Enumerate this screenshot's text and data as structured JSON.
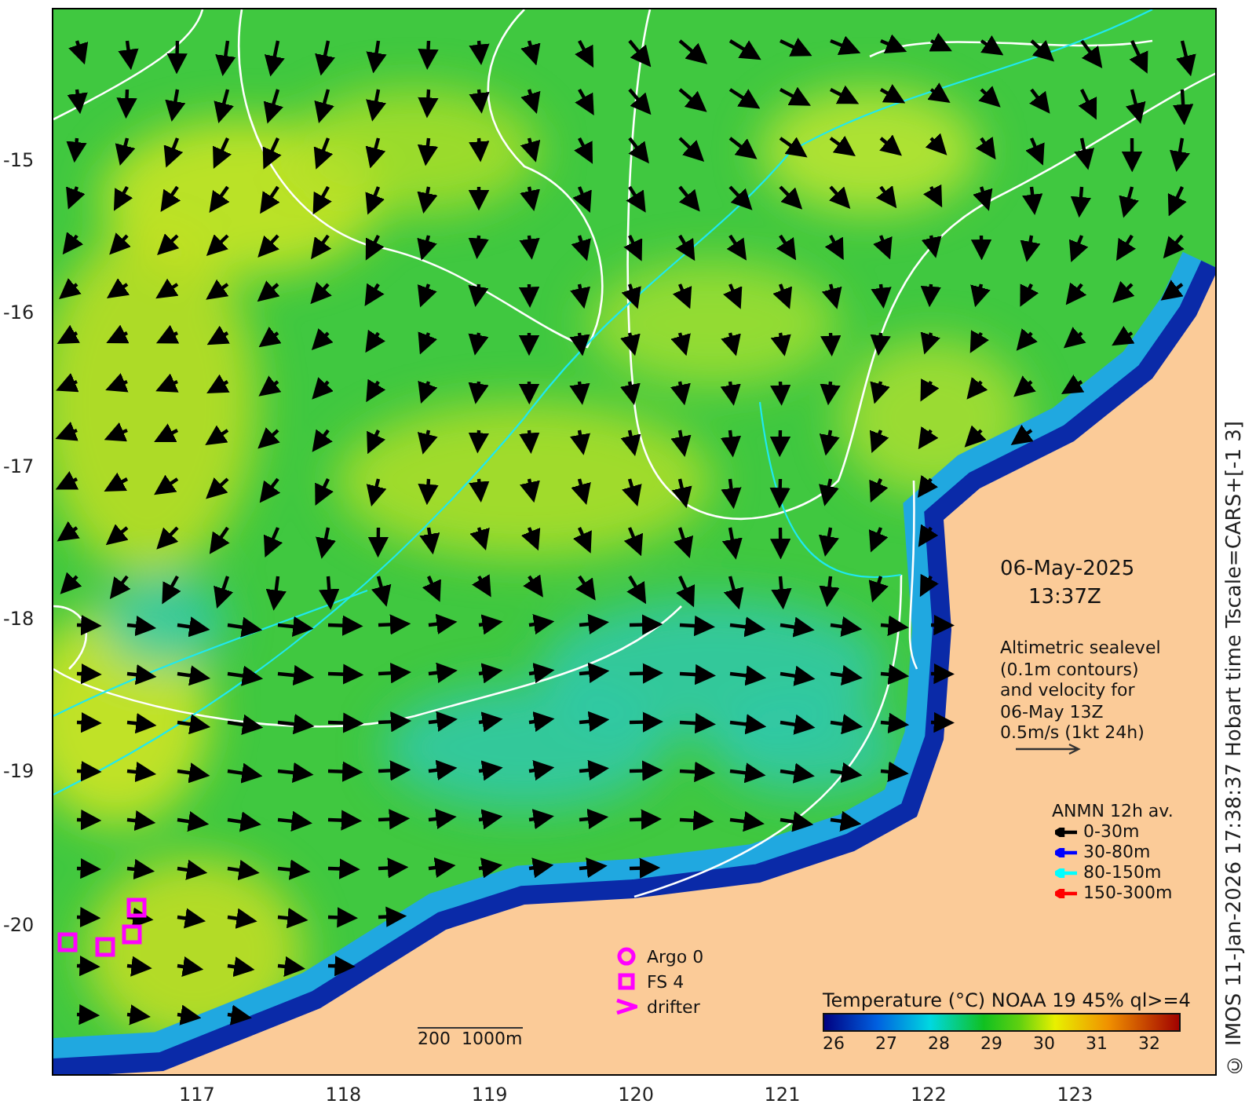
{
  "map": {
    "y_axis_labels": [
      "-15",
      "-16",
      "-17",
      "-18",
      "-19",
      "-20"
    ],
    "x_axis_labels": [
      "117",
      "118",
      "119",
      "120",
      "121",
      "122",
      "123"
    ],
    "date": "06-May-2025",
    "time": "13:37Z",
    "description_lines": [
      "Altimetric sealevel",
      "(0.1m contours)",
      "and velocity for",
      "06-May 13Z",
      "0.5m/s (1kt 24h)"
    ],
    "anmn_legend": {
      "title": "ANMN 12h av.",
      "items": [
        {
          "label": "0-30m",
          "color": "#000000"
        },
        {
          "label": "30-80m",
          "color": "#0000ff"
        },
        {
          "label": "80-150m",
          "color": "#00ffff"
        },
        {
          "label": "150-300m",
          "color": "#ff0000"
        }
      ]
    },
    "platform_legend": [
      {
        "kind": "circle",
        "label": "Argo 0"
      },
      {
        "kind": "square",
        "label": "FS 4"
      },
      {
        "kind": "chevron",
        "label": "drifter"
      }
    ],
    "scale_bar_label": "200  1000m",
    "colorbar": {
      "title": "Temperature (°C) NOAA 19 45% ql>=4",
      "ticks": [
        "26",
        "27",
        "28",
        "29",
        "30",
        "31",
        "32"
      ]
    },
    "credit": "© IMOS 11-Jan-2026 17:38:37 Hobart time Tscale=CARS+[-1 3]"
  }
}
